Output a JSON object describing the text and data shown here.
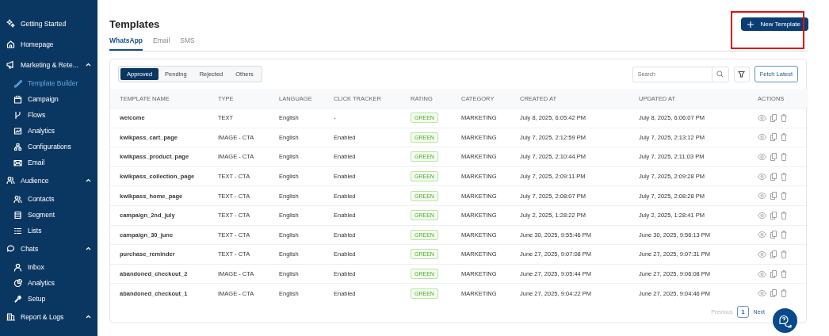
{
  "sidebar": {
    "items": [
      {
        "label": "Getting Started",
        "selected": false
      },
      {
        "label": "Homepage",
        "selected": false
      },
      {
        "label": "Marketing & Rete...",
        "selected": false,
        "expanded": true,
        "children": [
          {
            "label": "Template Builder",
            "selected": true
          },
          {
            "label": "Campaign",
            "selected": false
          },
          {
            "label": "Flows",
            "selected": false
          },
          {
            "label": "Analytics",
            "selected": false
          },
          {
            "label": "Configurations",
            "selected": false
          },
          {
            "label": "Email",
            "selected": false
          }
        ]
      },
      {
        "label": "Audience",
        "selected": false,
        "expanded": true,
        "children": [
          {
            "label": "Contacts",
            "selected": false
          },
          {
            "label": "Segment",
            "selected": false
          },
          {
            "label": "Lists",
            "selected": false
          }
        ]
      },
      {
        "label": "Chats",
        "selected": false,
        "expanded": true,
        "children": [
          {
            "label": "Inbox",
            "selected": false
          },
          {
            "label": "Analytics",
            "selected": false
          },
          {
            "label": "Setup",
            "selected": false
          }
        ]
      },
      {
        "label": "Report & Logs",
        "selected": false,
        "expanded": true
      }
    ]
  },
  "header": {
    "title": "Templates",
    "new_button": {
      "label": "New Template",
      "highlighted": true
    }
  },
  "tabs": [
    {
      "label": "WhatsApp",
      "selected": true
    },
    {
      "label": "Email",
      "selected": false
    },
    {
      "label": "SMS",
      "selected": false
    }
  ],
  "filters": [
    {
      "label": "Approved",
      "selected": true
    },
    {
      "label": "Pending",
      "selected": false
    },
    {
      "label": "Rejected",
      "selected": false
    },
    {
      "label": "Others",
      "selected": false
    }
  ],
  "search": {
    "placeholder": "Search"
  },
  "fetch_button": "Fetch Latest",
  "table": {
    "columns": [
      "TEMPLATE NAME",
      "TYPE",
      "LANGUAGE",
      "CLICK TRACKER",
      "RATING",
      "CATEGORY",
      "CREATED AT",
      "UPDATED AT",
      "ACTIONS"
    ],
    "rows": [
      {
        "name": "welcome",
        "type": "TEXT",
        "language": "English",
        "click_tracker": "-",
        "rating": "GREEN",
        "category": "MARKETING",
        "created": "July 8, 2025, 6:05:42 PM",
        "updated": "July 8, 2025, 6:06:07 PM"
      },
      {
        "name": "kwikpass_cart_page",
        "type": "IMAGE - CTA",
        "language": "English",
        "click_tracker": "Enabled",
        "rating": "GREEN",
        "category": "MARKETING",
        "created": "July 7, 2025, 2:12:59 PM",
        "updated": "July 7, 2025, 2:13:12 PM"
      },
      {
        "name": "kwikpass_product_page",
        "type": "IMAGE - CTA",
        "language": "English",
        "click_tracker": "Enabled",
        "rating": "GREEN",
        "category": "MARKETING",
        "created": "July 7, 2025, 2:10:44 PM",
        "updated": "July 7, 2025, 2:11:03 PM"
      },
      {
        "name": "kwikpass_collection_page",
        "type": "TEXT - CTA",
        "language": "English",
        "click_tracker": "Enabled",
        "rating": "GREEN",
        "category": "MARKETING",
        "created": "July 7, 2025, 2:09:11 PM",
        "updated": "July 7, 2025, 2:09:28 PM"
      },
      {
        "name": "kwikpass_home_page",
        "type": "TEXT - CTA",
        "language": "English",
        "click_tracker": "Enabled",
        "rating": "GREEN",
        "category": "MARKETING",
        "created": "July 7, 2025, 2:08:07 PM",
        "updated": "July 7, 2025, 2:08:28 PM"
      },
      {
        "name": "campaign_2nd_july",
        "type": "TEXT - CTA",
        "language": "English",
        "click_tracker": "Enabled",
        "rating": "GREEN",
        "category": "MARKETING",
        "created": "July 2, 2025, 1:28:22 PM",
        "updated": "July 2, 2025, 1:28:41 PM"
      },
      {
        "name": "campaign_30_june",
        "type": "TEXT - CTA",
        "language": "English",
        "click_tracker": "Enabled",
        "rating": "GREEN",
        "category": "MARKETING",
        "created": "June 30, 2025, 9:55:46 PM",
        "updated": "June 30, 2025, 9:56:13 PM"
      },
      {
        "name": "purchase_reminder",
        "type": "TEXT - CTA",
        "language": "English",
        "click_tracker": "Enabled",
        "rating": "GREEN",
        "category": "MARKETING",
        "created": "June 27, 2025, 9:07:08 PM",
        "updated": "June 27, 2025, 9:07:31 PM"
      },
      {
        "name": "abandoned_checkout_2",
        "type": "IMAGE - CTA",
        "language": "English",
        "click_tracker": "Enabled",
        "rating": "GREEN",
        "category": "MARKETING",
        "created": "June 27, 2025, 9:05:44 PM",
        "updated": "June 27, 2025, 9:06:08 PM"
      },
      {
        "name": "abandoned_checkout_1",
        "type": "IMAGE - CTA",
        "language": "English",
        "click_tracker": "Enabled",
        "rating": "GREEN",
        "category": "MARKETING",
        "created": "June 27, 2025, 9:04:22 PM",
        "updated": "June 27, 2025, 9:04:46 PM"
      }
    ]
  },
  "pagination": {
    "previous": "Previous",
    "pages": [
      {
        "label": "1",
        "selected": true
      }
    ],
    "next": "Next",
    "previous_disabled": true
  }
}
